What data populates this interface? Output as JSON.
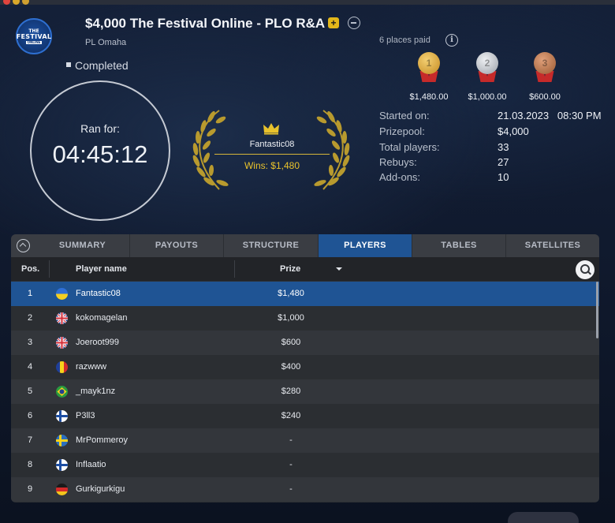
{
  "tournament": {
    "title": "$4,000 The Festival Online - PLO R&A",
    "game": "PL Omaha",
    "status": "Completed",
    "logo_text": [
      "THE",
      "FESTIVAL",
      "ONLINE"
    ]
  },
  "timer": {
    "label": "Ran for:",
    "value": "04:45:12"
  },
  "winner": {
    "name": "Fantastic08",
    "wins": "Wins: $1,480"
  },
  "payouts": {
    "places_paid": "6 places paid",
    "medals": [
      {
        "rank": "1",
        "amount": "$1,480.00",
        "color": "#d9a233"
      },
      {
        "rank": "2",
        "amount": "$1,000.00",
        "color": "#b9bdc4"
      },
      {
        "rank": "3",
        "amount": "$600.00",
        "color": "#b8734a"
      }
    ]
  },
  "stats": [
    {
      "label": "Started on:",
      "value": "21.03.2023   08:30 PM"
    },
    {
      "label": "Prizepool:",
      "value": "$4,000"
    },
    {
      "label": "Total players:",
      "value": "33"
    },
    {
      "label": "Rebuys:",
      "value": "27"
    },
    {
      "label": "Add-ons:",
      "value": "10"
    }
  ],
  "tabs": [
    "SUMMARY",
    "PAYOUTS",
    "STRUCTURE",
    "PLAYERS",
    "TABLES",
    "SATELLITES"
  ],
  "active_tab": "PLAYERS",
  "table": {
    "headers": {
      "pos": "Pos.",
      "name": "Player name",
      "prize": "Prize"
    },
    "rows": [
      {
        "pos": "1",
        "name": "Fantastic08",
        "prize": "$1,480",
        "flag": "ukraine"
      },
      {
        "pos": "2",
        "name": "kokomagelan",
        "prize": "$1,000",
        "flag": "united-kingdom"
      },
      {
        "pos": "3",
        "name": "Joeroot999",
        "prize": "$600",
        "flag": "united-kingdom"
      },
      {
        "pos": "4",
        "name": "razwww",
        "prize": "$400",
        "flag": "romania"
      },
      {
        "pos": "5",
        "name": "_mayk1nz",
        "prize": "$280",
        "flag": "brazil"
      },
      {
        "pos": "6",
        "name": "P3ll3",
        "prize": "$240",
        "flag": "finland"
      },
      {
        "pos": "7",
        "name": "MrPommeroy",
        "prize": "-",
        "flag": "sweden"
      },
      {
        "pos": "8",
        "name": "Inflaatio",
        "prize": "-",
        "flag": "finland"
      },
      {
        "pos": "9",
        "name": "Gurkigurkigu",
        "prize": "-",
        "flag": "germany"
      }
    ]
  },
  "colors": {
    "accent": "#1f5494",
    "gold": "#e8c22c",
    "panel": "#2d3035"
  }
}
